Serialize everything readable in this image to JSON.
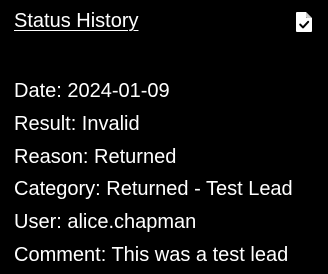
{
  "panel": {
    "title": "Status History",
    "icon": "document-check-icon"
  },
  "entry": {
    "date": "Date: 2024-01-09",
    "result": "Result: Invalid",
    "reason": "Reason: Returned",
    "category": "Category: Returned - Test Lead",
    "user": "User: alice.chapman",
    "comment": "Comment: This was a test lead"
  }
}
